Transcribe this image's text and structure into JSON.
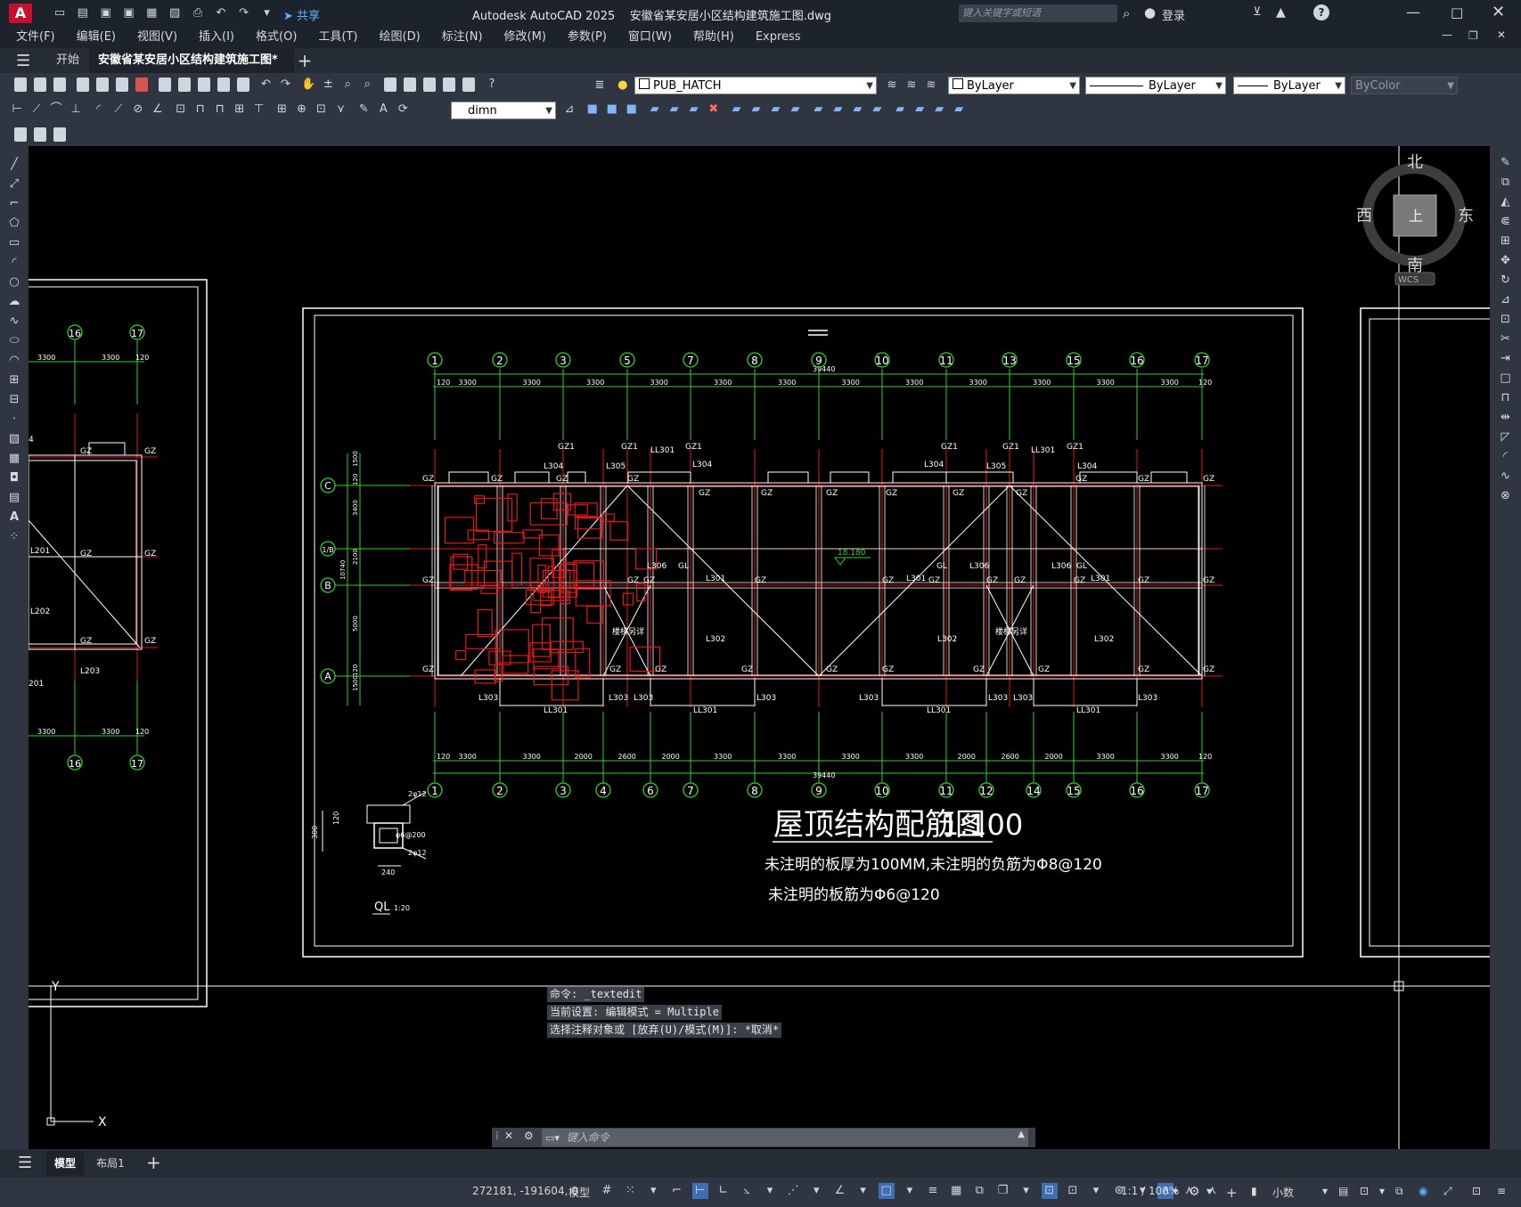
{
  "app": {
    "logo_letter": "A",
    "title": "Autodesk AutoCAD 2025    安徽省某安居小区结构建筑施工图.dwg",
    "share_label": "共享",
    "search_placeholder": "键入关键字或短语",
    "login_label": "登录"
  },
  "menu": [
    "文件(F)",
    "编辑(E)",
    "视图(V)",
    "插入(I)",
    "格式(O)",
    "工具(T)",
    "绘图(D)",
    "标注(N)",
    "修改(M)",
    "参数(P)",
    "窗口(W)",
    "帮助(H)",
    "Express"
  ],
  "tabs": {
    "home": "开始",
    "file": "安徽省某安居小区结构建筑施工图*",
    "add": "+"
  },
  "toolbar": {
    "layer": "PUB_HATCH",
    "color": "ByLayer",
    "linetype": "ByLayer",
    "lineweight": "ByLayer",
    "plotstyle": "ByColor",
    "dimstyle": "dimn"
  },
  "viewcube": {
    "north": "北",
    "south": "南",
    "east": "东",
    "west": "西",
    "top": "上",
    "wcs": "WCS"
  },
  "drawing": {
    "title": "屋顶结构配筋图",
    "scale": "1:100",
    "note1": "未注明的板厚为100MM,未注明的负筋为Φ8@120",
    "note2": "未注明的板筋为Φ6@120",
    "top_axes": [
      "1",
      "2",
      "3",
      "5",
      "7",
      "8",
      "9",
      "10",
      "11",
      "13",
      "15",
      "16",
      "17"
    ],
    "bottom_axes": [
      "1",
      "2",
      "3",
      "4",
      "6",
      "7",
      "8",
      "9",
      "10",
      "11",
      "12",
      "14",
      "15",
      "16",
      "17"
    ],
    "left_axes": [
      "C",
      "1/B",
      "B",
      "A"
    ],
    "top_dims": [
      "120",
      "3300",
      "3300",
      "3300",
      "3300",
      "3300",
      "3300",
      "3300",
      "3300",
      "3300",
      "3300",
      "3300",
      "3300",
      "120"
    ],
    "bottom_dims": [
      "120",
      "3300",
      "3300",
      "2000",
      "2600",
      "2000",
      "3300",
      "3300",
      "3300",
      "3300",
      "2000",
      "2600",
      "2000",
      "3300",
      "3300",
      "120"
    ],
    "total_dim": "39440",
    "left_dims": [
      "1500",
      "120",
      "3400",
      "2100",
      "10740",
      "5000",
      "120",
      "1500"
    ],
    "elev": "18.180",
    "stair": "楼梯另详",
    "ql_label": "QL",
    "ql_scale": "1:20",
    "ql_dims": [
      "300",
      "120",
      "240",
      "2φ12",
      "φ6@200",
      "2φ12"
    ],
    "labels": [
      "GZ",
      "GZ1",
      "L304",
      "L305",
      "LL301",
      "L306",
      "GL",
      "L301",
      "L302",
      "L303",
      "LL301"
    ],
    "left_sheet_axes": [
      "16",
      "17"
    ],
    "left_sheet_dims": [
      "3300",
      "3300",
      "120"
    ],
    "left_sheet_labels": [
      "L201",
      "L202",
      "L203",
      "GZ",
      "201",
      "4"
    ]
  },
  "command": {
    "history": [
      "命令:  _textedit",
      "当前设置: 编辑模式 = Multiple",
      "选择注释对象或 [放弃(U)/模式(M)]: *取消*"
    ],
    "placeholder": "键入命令"
  },
  "layout_tabs": [
    "模型",
    "布局1"
  ],
  "status": {
    "coords": "272181, -191604, 0",
    "model": "模型",
    "scale": "1:1 / 100%",
    "units": "小数"
  }
}
